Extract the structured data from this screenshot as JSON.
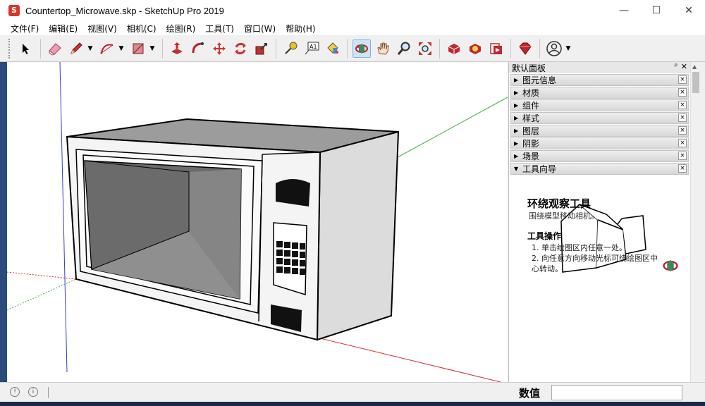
{
  "window": {
    "title": "Countertop_Microwave.skp - SketchUp Pro 2019",
    "app_icon": "sketchup-icon",
    "controls": {
      "minimize": "—",
      "maximize": "☐",
      "close": "✕"
    }
  },
  "menu": {
    "items": [
      "文件(F)",
      "编辑(E)",
      "视图(V)",
      "相机(C)",
      "绘图(R)",
      "工具(T)",
      "窗口(W)",
      "帮助(H)"
    ]
  },
  "toolbar": {
    "tools": [
      "select-tool",
      "eraser-tool",
      "pencil-tool",
      "arc-tool",
      "rectangle-tool",
      "pushpull-tool",
      "followme-tool",
      "move-tool",
      "rotate-tool",
      "scale-tool",
      "tape-measure-tool",
      "text-tool",
      "paint-bucket-tool",
      "orbit-tool",
      "pan-tool",
      "zoom-tool",
      "zoom-extents-tool",
      "3d-warehouse-tool",
      "extension-warehouse-tool",
      "layout-tool",
      "ruby-tool",
      "account-tool"
    ],
    "active": "orbit-tool",
    "text_tool_label": "A1"
  },
  "tray": {
    "title": "默认面板",
    "pin": "ᵖ",
    "close": "✕",
    "panels": [
      {
        "label": "图元信息",
        "expanded": false
      },
      {
        "label": "材质",
        "expanded": false
      },
      {
        "label": "组件",
        "expanded": false
      },
      {
        "label": "样式",
        "expanded": false
      },
      {
        "label": "图层",
        "expanded": false
      },
      {
        "label": "阴影",
        "expanded": false
      },
      {
        "label": "场景",
        "expanded": false
      },
      {
        "label": "工具向导",
        "expanded": true
      }
    ],
    "panel_close": "×",
    "instructor": {
      "title": "环绕观察工具",
      "subtitle": "围绕模型移动相机。",
      "ops_title": "工具操作",
      "steps": [
        "1. 单击绘图区内任意一处。",
        "2. 向任意方向移动光标可绕绘图区中",
        "   心转动。"
      ]
    }
  },
  "status": {
    "measurements_label": "数值",
    "measurements_value": "",
    "geo_icon": "geo-location-icon",
    "credits_icon": "credits-icon",
    "help_icon": "help-icon"
  },
  "colors": {
    "accent": "#cfe3f7",
    "axis_red": "#d03030",
    "axis_green": "#30a030",
    "axis_blue": "#3030c0"
  }
}
